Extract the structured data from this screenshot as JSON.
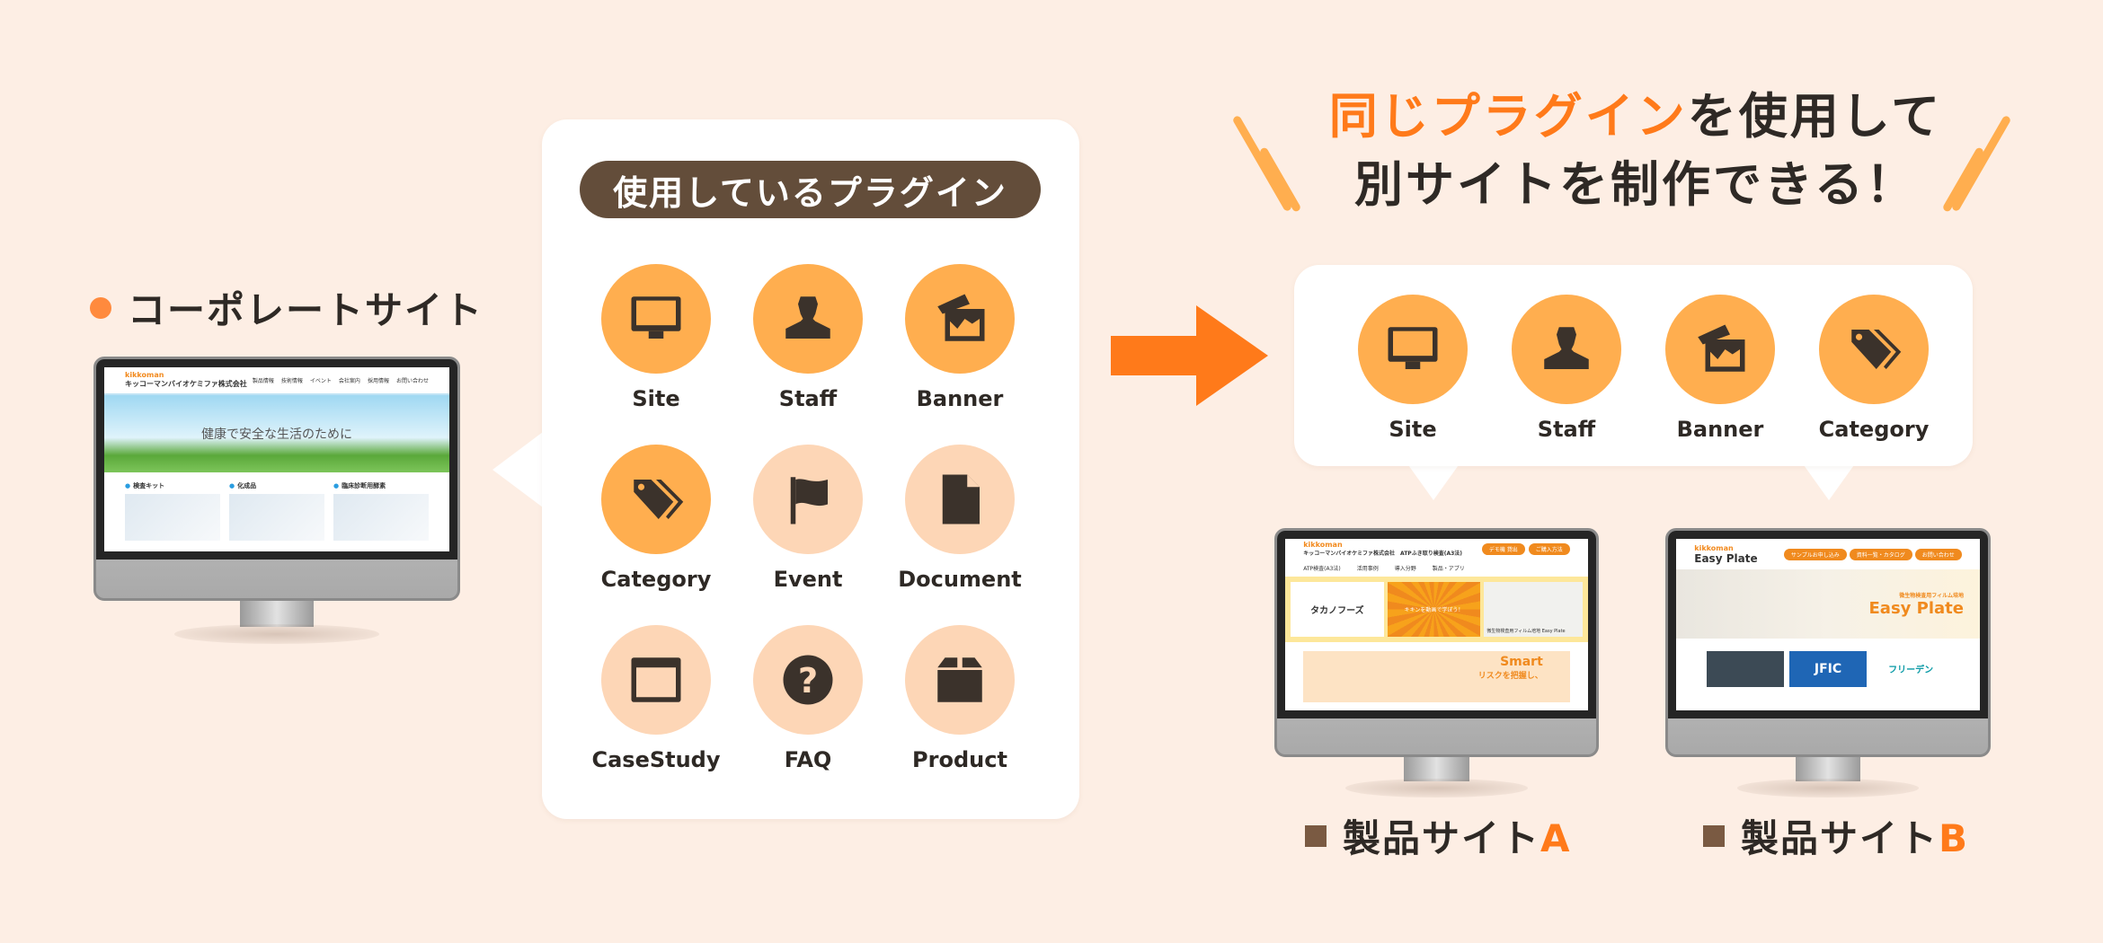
{
  "corporate": {
    "label": "コーポレートサイト",
    "screen": {
      "brand": "kikkoman",
      "company": "キッコーマンバイオケミファ株式会社",
      "nav": [
        "製品情報",
        "技術情報",
        "イベント",
        "会社案内",
        "採用情報",
        "お問い合わせ"
      ],
      "hero_title": "健康で安全な生活のために",
      "sections": [
        "検査キット",
        "化成品",
        "臨床診断用酵素"
      ]
    }
  },
  "plugin_box": {
    "title": "使用しているプラグイン",
    "plugins": [
      {
        "label": "Site",
        "icon": "monitor-icon",
        "active": true
      },
      {
        "label": "Staff",
        "icon": "person-icon",
        "active": true
      },
      {
        "label": "Banner",
        "icon": "images-icon",
        "active": true
      },
      {
        "label": "Category",
        "icon": "tags-icon",
        "active": true
      },
      {
        "label": "Event",
        "icon": "flag-icon",
        "active": false
      },
      {
        "label": "Document",
        "icon": "document-icon",
        "active": false
      },
      {
        "label": "CaseStudy",
        "icon": "browser-window-icon",
        "active": false
      },
      {
        "label": "FAQ",
        "icon": "question-icon",
        "active": false
      },
      {
        "label": "Product",
        "icon": "box-icon",
        "active": false
      }
    ]
  },
  "headline": {
    "line1_accent": "同じプラグイン",
    "line1_rest": "を使用して",
    "line2": "別サイトを制作できる！"
  },
  "shared_box": {
    "plugins": [
      {
        "label": "Site",
        "icon": "monitor-icon",
        "active": true
      },
      {
        "label": "Staff",
        "icon": "person-icon",
        "active": true
      },
      {
        "label": "Banner",
        "icon": "images-icon",
        "active": true
      },
      {
        "label": "Category",
        "icon": "tags-icon",
        "active": true
      }
    ]
  },
  "product_a": {
    "label": "製品サイト",
    "letter": "A",
    "screen": {
      "brand": "kikkoman",
      "company": "キッコーマンバイオケミファ株式会社　ATPふき取り検査(A3法)",
      "buttons": [
        "デモ機 貸出",
        "ご購入方法"
      ],
      "nav": [
        "ATP検査(A3法)",
        "活用事例",
        "導入分野",
        "製品・アプリ"
      ],
      "cards": [
        "タカノフーズ",
        "キキンを動画で学ぼう！",
        "微生物検査用フィルム培地 Easy Plate"
      ],
      "banner_title": "Smart",
      "banner_text": "リスクを把握し、"
    }
  },
  "product_b": {
    "label": "製品サイト",
    "letter": "B",
    "screen": {
      "brand": "kikkoman",
      "title": "Easy Plate",
      "buttons": [
        "サンプルお申し込み",
        "資料一覧・カタログ",
        "お問い合わせ"
      ],
      "hero_sub": "微生物検査用フィルム培地",
      "hero_title": "Easy Plate",
      "logos": [
        "JFIC",
        "フリーデン"
      ]
    }
  },
  "colors": {
    "background": "#fdeee4",
    "accent": "#ff7a1a",
    "active_circle": "#ffae4f",
    "inactive_circle": "#fdd6b6",
    "pill": "#634d3a",
    "icon": "#3b322b"
  }
}
